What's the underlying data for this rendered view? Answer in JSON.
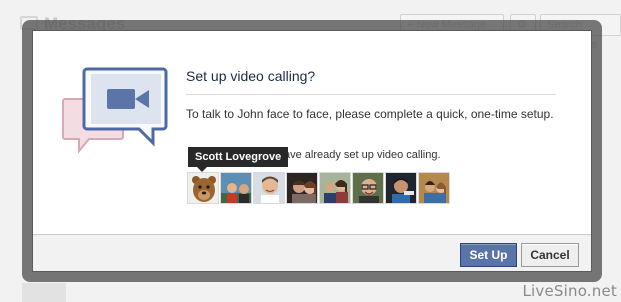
{
  "background": {
    "title": "Messages",
    "new_message_label": "+ New Message",
    "search_label": "Search Messages"
  },
  "dialog": {
    "title": "Set up video calling?",
    "body": "To talk to John face to face, please complete a quick, one-time setup.",
    "friends_text": "ave already set up video calling.",
    "tooltip": "Scott Lovegrove",
    "hero_icon": "video-camera-speech-bubbles-icon",
    "friends": [
      {
        "name": "Scott Lovegrove"
      },
      {
        "name": ""
      },
      {
        "name": ""
      },
      {
        "name": ""
      },
      {
        "name": ""
      },
      {
        "name": ""
      },
      {
        "name": ""
      },
      {
        "name": ""
      }
    ]
  },
  "footer": {
    "primary_label": "Set Up",
    "cancel_label": "Cancel"
  },
  "watermark": "LiveSino.net",
  "colors": {
    "primary": "#5b74a8",
    "primary_border": "#29447e",
    "title": "#1c2a47",
    "overlay": "#525252"
  }
}
